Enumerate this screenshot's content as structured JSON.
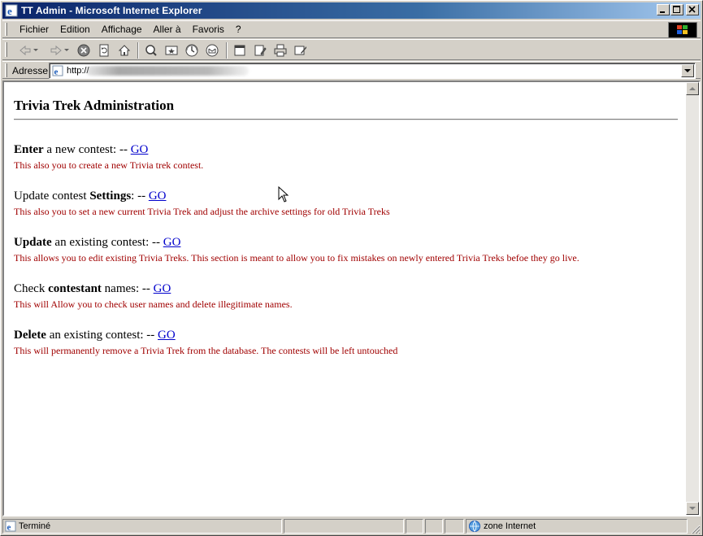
{
  "window": {
    "title": "TT Admin - Microsoft Internet Explorer"
  },
  "menu": {
    "items": [
      {
        "label": "Fichier"
      },
      {
        "label": "Edition"
      },
      {
        "label": "Affichage"
      },
      {
        "label": "Aller à"
      },
      {
        "label": "Favoris"
      },
      {
        "label": "?"
      }
    ]
  },
  "toolbar": {
    "buttons": [
      "back-icon",
      "forward-icon",
      "stop-icon",
      "refresh-icon",
      "home-icon",
      "search-icon",
      "favorites-icon",
      "history-icon",
      "mail-icon",
      "fullscreen-icon",
      "edit-icon",
      "print-icon",
      "discuss-icon"
    ]
  },
  "address": {
    "label": "Adresse",
    "url": "http://"
  },
  "page": {
    "title": "Trivia Trek Administration",
    "sections": [
      {
        "pre": "",
        "bold": "Enter",
        "post": " a new contest: -- ",
        "link": "GO",
        "description": "This also you to create a new Trivia trek contest."
      },
      {
        "pre": "Update contest ",
        "bold": "Settings",
        "post": ": -- ",
        "link": "GO",
        "description": "This also you to set a new current Trivia Trek and adjust the archive settings for old Trivia Treks"
      },
      {
        "pre": "",
        "bold": "Update",
        "post": " an existing contest: -- ",
        "link": "GO",
        "description": "This allows you to edit existing Trivia Treks. This section is meant to allow you to fix mistakes on newly entered Trivia Treks befoe they go live."
      },
      {
        "pre": "Check ",
        "bold": "contestant",
        "post": " names: -- ",
        "link": "GO",
        "description": "This will Allow you to check user names and delete illegitimate names."
      },
      {
        "pre": "",
        "bold": "Delete",
        "post": " an existing contest: -- ",
        "link": "GO",
        "description": "This will permanently remove a Trivia Trek from the database. The contests will be left untouched"
      }
    ]
  },
  "status": {
    "text": "Terminé",
    "zone": "zone Internet"
  },
  "colors": {
    "link": "#0000cc",
    "description": "#a00000",
    "titlebar_start": "#0a246a",
    "titlebar_end": "#a6caf0"
  }
}
